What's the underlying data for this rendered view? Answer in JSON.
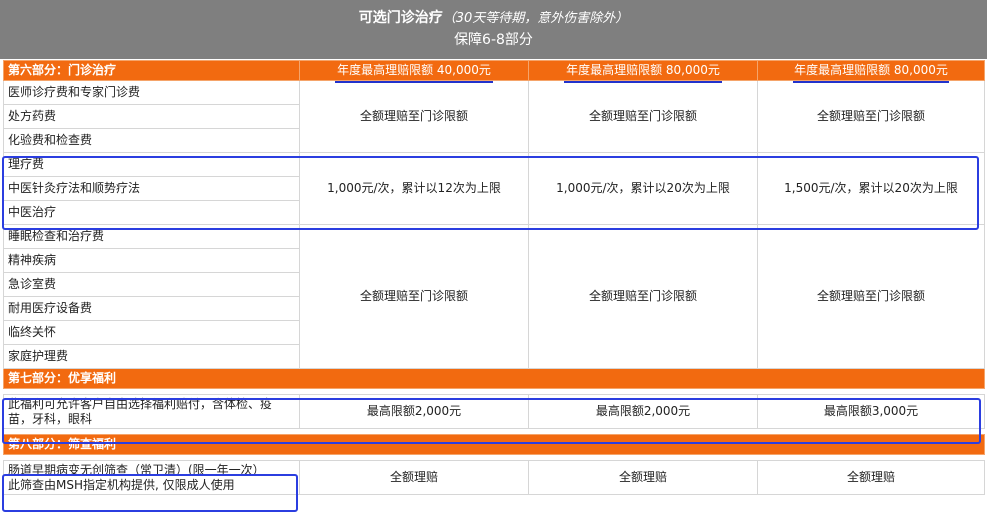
{
  "header": {
    "title": "可选门诊治疗",
    "note": "（30天等待期，意外伤害除外）",
    "subtitle": "保障6-8部分"
  },
  "section6": {
    "title": "第六部分：门诊治疗",
    "limits": [
      "年度最高理赔限额 40,000元",
      "年度最高理赔限额 80,000元",
      "年度最高理赔限额 80,000元"
    ],
    "groups": [
      {
        "items": [
          "医师诊疗费和专家门诊费",
          "处方药费",
          "化验费和检查费"
        ],
        "values": [
          "全额理赔至门诊限额",
          "全额理赔至门诊限额",
          "全额理赔至门诊限额"
        ]
      },
      {
        "items": [
          "理疗费",
          "中医针灸疗法和顺势疗法",
          "中医治疗"
        ],
        "values": [
          "1,000元/次，累计以12次为上限",
          "1,000元/次，累计以20次为上限",
          "1,500元/次，累计以20次为上限"
        ]
      },
      {
        "items": [
          "睡眠检查和治疗费",
          "精神疾病",
          "急诊室费",
          "耐用医疗设备费",
          "临终关怀",
          "家庭护理费"
        ],
        "values": [
          "全额理赔至门诊限额",
          "全额理赔至门诊限额",
          "全额理赔至门诊限额"
        ]
      }
    ]
  },
  "section7": {
    "title": "第七部分：优享福利",
    "item": "此福利可允许客户自由选择福利赔付，含体检、疫苗，牙科，眼科",
    "values": [
      "最高限额2,000元",
      "最高限额2,000元",
      "最高限额3,000元"
    ]
  },
  "section8": {
    "title": "第八部分：筛查福利",
    "item_line1": "肠道早期病变无创筛查（常卫清）(限一年一次）",
    "item_line2": "此筛查由MSH指定机构提供, 仅限成人使用",
    "values": [
      "全额理赔",
      "全额理赔",
      "全额理赔"
    ]
  }
}
